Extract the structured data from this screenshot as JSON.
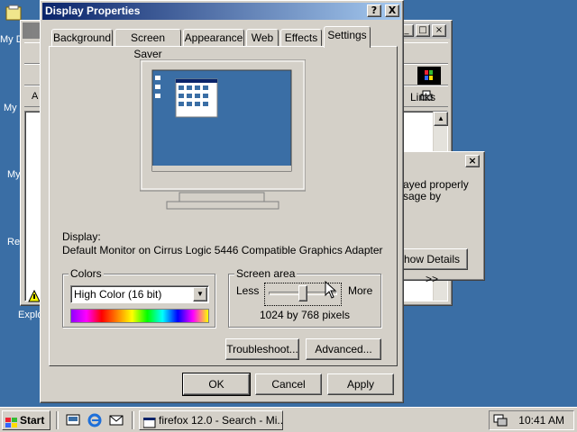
{
  "desktop": {
    "labels": [
      "My D",
      "My",
      "My",
      "Re",
      "Explo"
    ]
  },
  "background_window": {
    "links_label": "Links",
    "address_fragment": "A"
  },
  "popup": {
    "line1": "ayed properly",
    "line2": "sage by",
    "details_button": "how Details >>"
  },
  "dialog": {
    "title": "Display Properties",
    "help_btn": "?",
    "close_btn": "X",
    "tabs": [
      "Background",
      "Screen Saver",
      "Appearance",
      "Web",
      "Effects",
      "Settings"
    ],
    "active_tab": "Settings",
    "display_label": "Display:",
    "display_value": "Default Monitor on Cirrus Logic 5446 Compatible Graphics Adapter",
    "colors_label": "Colors",
    "colors_value": "High Color (16 bit)",
    "screen_area_label": "Screen area",
    "less_label": "Less",
    "more_label": "More",
    "resolution_text": "1024 by 768 pixels",
    "slider_level_fraction": 0.5,
    "troubleshoot_btn": "Troubleshoot...",
    "advanced_btn": "Advanced...",
    "ok_btn": "OK",
    "cancel_btn": "Cancel",
    "apply_btn": "Apply"
  },
  "taskbar": {
    "start_label": "Start",
    "task_label": "firefox 12.0 - Search - Mi...",
    "clock": "10:41 AM"
  }
}
